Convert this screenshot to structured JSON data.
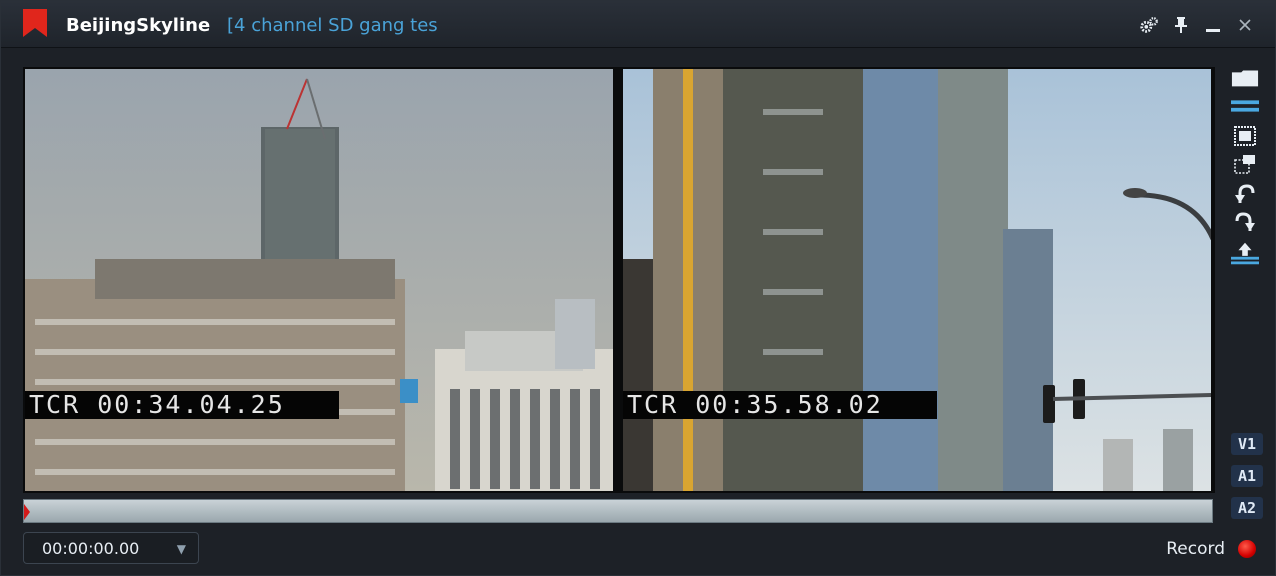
{
  "window": {
    "title": "BeijingSkyline",
    "subtitle": "[4 channel SD gang tes",
    "accent_color": "#4aa3d8",
    "controls": {
      "settings_icon": "gears-icon",
      "pin_icon": "pin-icon",
      "minimize_icon": "minimize-icon",
      "close_icon": "close-icon"
    }
  },
  "viewers": [
    {
      "name": "left",
      "tcr": "TCR 00:34.04.25"
    },
    {
      "name": "right",
      "tcr": "TCR 00:35.58.02"
    }
  ],
  "side_tools": [
    "folder-icon",
    "lines-icon",
    "single-frame-icon",
    "multi-frame-icon",
    "undo-icon",
    "redo-icon",
    "upload-icon"
  ],
  "tracks": [
    "V1",
    "A1",
    "A2"
  ],
  "timeline": {
    "position": 0
  },
  "bottom": {
    "timecode": "00:00:00.00",
    "record_label": "Record",
    "record_color": "#d40000"
  }
}
